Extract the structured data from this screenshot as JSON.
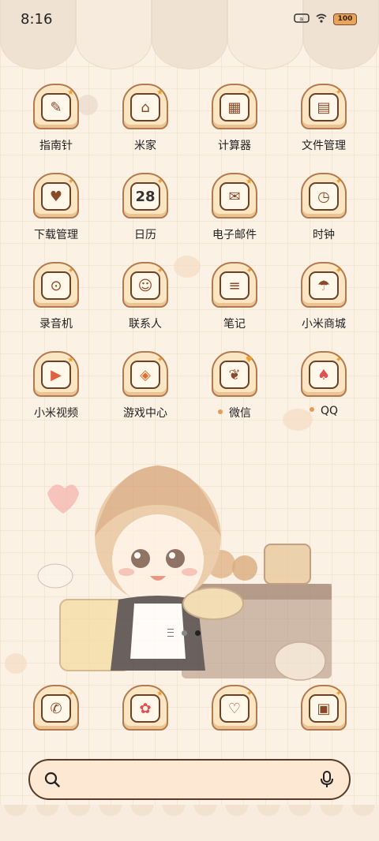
{
  "status_bar": {
    "time": "8:16",
    "battery": "100",
    "icons": [
      "bluetooth-icon",
      "wifi-icon",
      "battery-icon"
    ]
  },
  "apps": [
    {
      "label": "指南针",
      "icon": "compass-icon",
      "glyph": "✎"
    },
    {
      "label": "米家",
      "icon": "home-icon",
      "glyph": "⌂"
    },
    {
      "label": "计算器",
      "icon": "calculator-icon",
      "glyph": "▦"
    },
    {
      "label": "文件管理",
      "icon": "folder-icon",
      "glyph": "▤"
    },
    {
      "label": "下载管理",
      "icon": "download-icon",
      "glyph": "♥"
    },
    {
      "label": "日历",
      "icon": "calendar-icon",
      "glyph": "28"
    },
    {
      "label": "电子邮件",
      "icon": "mail-icon",
      "glyph": "✉"
    },
    {
      "label": "时钟",
      "icon": "clock-icon",
      "glyph": "◷"
    },
    {
      "label": "录音机",
      "icon": "recorder-icon",
      "glyph": "⊙"
    },
    {
      "label": "联系人",
      "icon": "contacts-icon",
      "glyph": "☺"
    },
    {
      "label": "笔记",
      "icon": "notes-icon",
      "glyph": "≡"
    },
    {
      "label": "小米商城",
      "icon": "umbrella-icon",
      "glyph": "☂"
    },
    {
      "label": "小米视频",
      "icon": "video-icon",
      "glyph": "▶"
    },
    {
      "label": "游戏中心",
      "icon": "game-icon",
      "glyph": "◈"
    },
    {
      "label": "微信",
      "icon": "wechat-icon",
      "glyph": "❦",
      "badge": true
    },
    {
      "label": "QQ",
      "icon": "qq-icon",
      "glyph": "♠",
      "badge": true
    }
  ],
  "dock": [
    {
      "icon": "phone-icon",
      "glyph": "✆"
    },
    {
      "icon": "messages-icon",
      "glyph": "✿"
    },
    {
      "icon": "browser-icon",
      "glyph": "♡"
    },
    {
      "icon": "gallery-icon",
      "glyph": "▣"
    }
  ],
  "page_indicator": {
    "pages": 2,
    "active": 2
  },
  "search": {
    "placeholder": ""
  },
  "colors": {
    "accent": "#e79a55",
    "outline": "#5a3a24",
    "toast": "#fbe6c4"
  }
}
